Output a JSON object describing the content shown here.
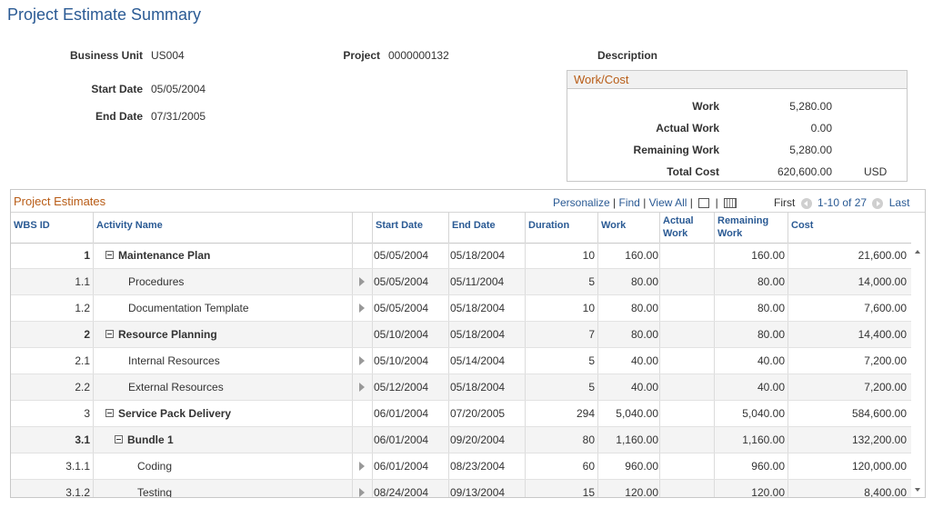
{
  "page": {
    "title": "Project Estimate Summary"
  },
  "header": {
    "business_unit_label": "Business Unit",
    "business_unit": "US004",
    "project_label": "Project",
    "project": "0000000132",
    "description_label": "Description",
    "start_date_label": "Start Date",
    "start_date": "05/05/2004",
    "end_date_label": "End Date",
    "end_date": "07/31/2005"
  },
  "work_cost": {
    "title": "Work/Cost",
    "work_label": "Work",
    "work": "5,280.00",
    "actual_work_label": "Actual Work",
    "actual_work": "0.00",
    "remaining_work_label": "Remaining Work",
    "remaining_work": "5,280.00",
    "total_cost_label": "Total Cost",
    "total_cost": "620,600.00",
    "currency": "USD"
  },
  "grid": {
    "title": "Project Estimates",
    "personalize": "Personalize",
    "find": "Find",
    "view_all": "View All",
    "first": "First",
    "range": "1-10 of 27",
    "last": "Last",
    "columns": {
      "wbs_id": "WBS ID",
      "activity_name": "Activity Name",
      "start_date": "Start Date",
      "end_date": "End Date",
      "duration": "Duration",
      "work": "Work",
      "actual_work_1": "Actual",
      "actual_work_2": "Work",
      "remaining_work_1": "Remaining",
      "remaining_work_2": "Work",
      "cost": "Cost"
    },
    "rows": [
      {
        "wbs": "1",
        "name": "Maintenance Plan",
        "start": "05/05/2004",
        "end": "05/18/2004",
        "duration": "10",
        "work": "160.00",
        "actual": "",
        "remaining": "160.00",
        "cost": "21,600.00"
      },
      {
        "wbs": "1.1",
        "name": "Procedures",
        "start": "05/05/2004",
        "end": "05/11/2004",
        "duration": "5",
        "work": "80.00",
        "actual": "",
        "remaining": "80.00",
        "cost": "14,000.00"
      },
      {
        "wbs": "1.2",
        "name": "Documentation Template",
        "start": "05/05/2004",
        "end": "05/18/2004",
        "duration": "10",
        "work": "80.00",
        "actual": "",
        "remaining": "80.00",
        "cost": "7,600.00"
      },
      {
        "wbs": "2",
        "name": "Resource Planning",
        "start": "05/10/2004",
        "end": "05/18/2004",
        "duration": "7",
        "work": "80.00",
        "actual": "",
        "remaining": "80.00",
        "cost": "14,400.00"
      },
      {
        "wbs": "2.1",
        "name": "Internal Resources",
        "start": "05/10/2004",
        "end": "05/14/2004",
        "duration": "5",
        "work": "40.00",
        "actual": "",
        "remaining": "40.00",
        "cost": "7,200.00"
      },
      {
        "wbs": "2.2",
        "name": "External Resources",
        "start": "05/12/2004",
        "end": "05/18/2004",
        "duration": "5",
        "work": "40.00",
        "actual": "",
        "remaining": "40.00",
        "cost": "7,200.00"
      },
      {
        "wbs": "3",
        "name": "Service Pack Delivery",
        "start": "06/01/2004",
        "end": "07/20/2005",
        "duration": "294",
        "work": "5,040.00",
        "actual": "",
        "remaining": "5,040.00",
        "cost": "584,600.00"
      },
      {
        "wbs": "3.1",
        "name": "Bundle 1",
        "start": "06/01/2004",
        "end": "09/20/2004",
        "duration": "80",
        "work": "1,160.00",
        "actual": "",
        "remaining": "1,160.00",
        "cost": "132,200.00"
      },
      {
        "wbs": "3.1.1",
        "name": "Coding",
        "start": "06/01/2004",
        "end": "08/23/2004",
        "duration": "60",
        "work": "960.00",
        "actual": "",
        "remaining": "960.00",
        "cost": "120,000.00"
      },
      {
        "wbs": "3.1.2",
        "name": "Testing",
        "start": "08/24/2004",
        "end": "09/13/2004",
        "duration": "15",
        "work": "120.00",
        "actual": "",
        "remaining": "120.00",
        "cost": "8,400.00"
      }
    ]
  }
}
